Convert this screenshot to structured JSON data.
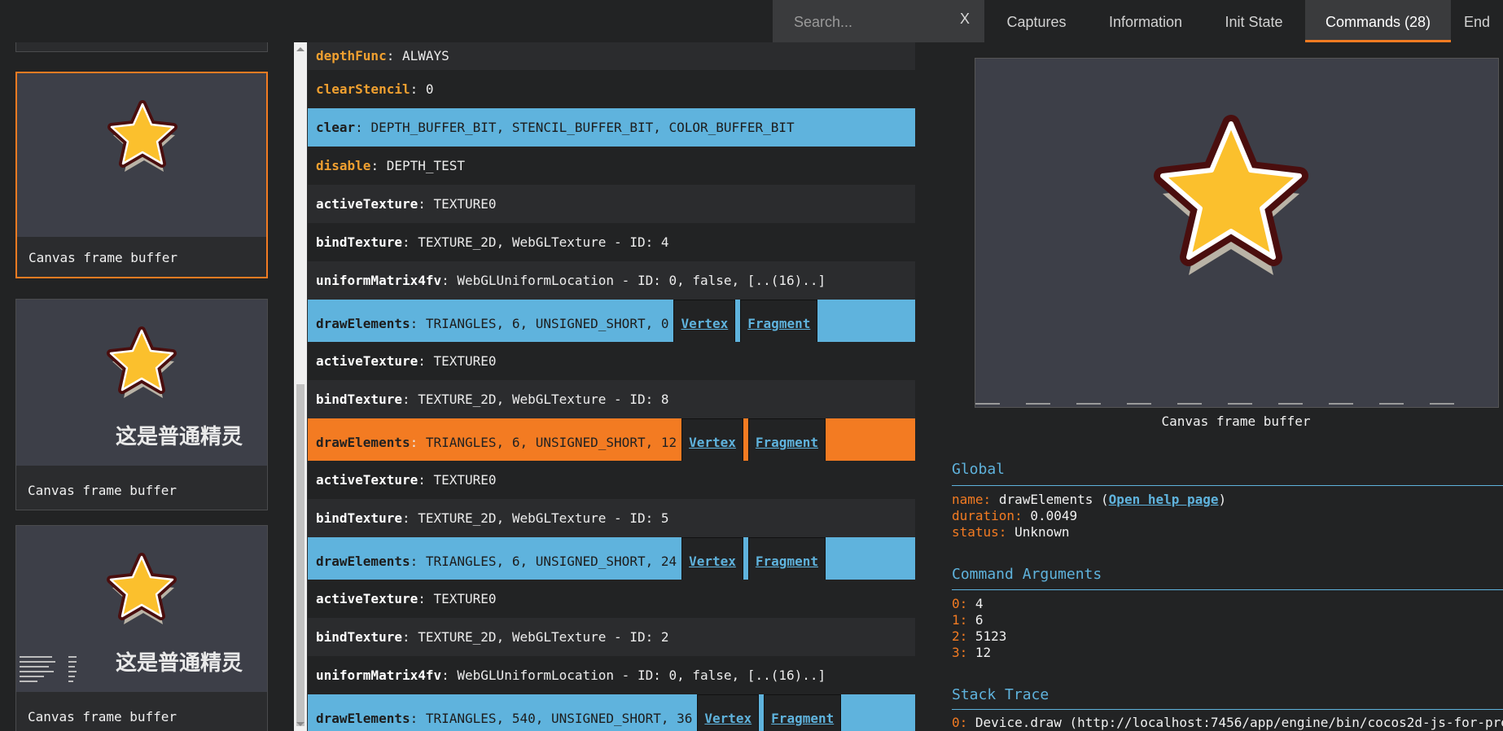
{
  "search": {
    "placeholder": "Search...",
    "clear_label": "X"
  },
  "tabs": [
    {
      "label": "Captures"
    },
    {
      "label": "Information"
    },
    {
      "label": "Init State"
    },
    {
      "label": "Commands (28)"
    },
    {
      "label": "End"
    }
  ],
  "thumbnails": [
    {
      "caption": "Canvas frame buffer",
      "overlay_text": ""
    },
    {
      "caption": "Canvas frame buffer",
      "overlay_text": "这是普通精灵"
    },
    {
      "caption": "Canvas frame buffer",
      "overlay_text": "这是普通精灵"
    }
  ],
  "commands": [
    {
      "name": "depthFunc",
      "args": "ALWAYS",
      "kind": "state"
    },
    {
      "name": "clearStencil",
      "args": "0",
      "kind": "state"
    },
    {
      "name": "clear",
      "args": "DEPTH_BUFFER_BIT, STENCIL_BUFFER_BIT, COLOR_BUFFER_BIT",
      "kind": "draw"
    },
    {
      "name": "disable",
      "args": "DEPTH_TEST",
      "kind": "state"
    },
    {
      "name": "activeTexture",
      "args": "TEXTURE0",
      "kind": "normal"
    },
    {
      "name": "bindTexture",
      "args": "TEXTURE_2D, WebGLTexture - ID: 4",
      "kind": "normal"
    },
    {
      "name": "uniformMatrix4fv",
      "args": "WebGLUniformLocation - ID: 0, false, [..(16)..]",
      "kind": "normal"
    },
    {
      "name": "drawElements",
      "args": "TRIANGLES, 6, UNSIGNED_SHORT, 0",
      "kind": "draw",
      "buttons": [
        "Vertex",
        "Fragment"
      ]
    },
    {
      "name": "activeTexture",
      "args": "TEXTURE0",
      "kind": "normal"
    },
    {
      "name": "bindTexture",
      "args": "TEXTURE_2D, WebGLTexture - ID: 8",
      "kind": "normal"
    },
    {
      "name": "drawElements",
      "args": "TRIANGLES, 6, UNSIGNED_SHORT, 12",
      "kind": "selected",
      "buttons": [
        "Vertex",
        "Fragment"
      ]
    },
    {
      "name": "activeTexture",
      "args": "TEXTURE0",
      "kind": "normal"
    },
    {
      "name": "bindTexture",
      "args": "TEXTURE_2D, WebGLTexture - ID: 5",
      "kind": "normal"
    },
    {
      "name": "drawElements",
      "args": "TRIANGLES, 6, UNSIGNED_SHORT, 24",
      "kind": "draw",
      "buttons": [
        "Vertex",
        "Fragment"
      ]
    },
    {
      "name": "activeTexture",
      "args": "TEXTURE0",
      "kind": "normal"
    },
    {
      "name": "bindTexture",
      "args": "TEXTURE_2D, WebGLTexture - ID: 2",
      "kind": "normal"
    },
    {
      "name": "uniformMatrix4fv",
      "args": "WebGLUniformLocation - ID: 0, false, [..(16)..]",
      "kind": "normal"
    },
    {
      "name": "drawElements",
      "args": "TRIANGLES, 540, UNSIGNED_SHORT, 36",
      "kind": "draw",
      "buttons": [
        "Vertex",
        "Fragment"
      ]
    }
  ],
  "preview": {
    "caption": "Canvas frame buffer"
  },
  "global": {
    "title": "Global",
    "name_key": "name:",
    "name_value": "drawElements",
    "help_link": "Open help page",
    "duration_key": "duration:",
    "duration_value": "0.0049",
    "status_key": "status:",
    "status_value": "Unknown"
  },
  "arguments": {
    "title": "Command Arguments",
    "items": [
      {
        "key": "0:",
        "value": "4"
      },
      {
        "key": "1:",
        "value": "6"
      },
      {
        "key": "2:",
        "value": "5123"
      },
      {
        "key": "3:",
        "value": "12"
      }
    ]
  },
  "stack": {
    "title": "Stack Trace",
    "items": [
      {
        "key": "0:",
        "value": "Device.draw (http://localhost:7456/app/engine/bin/cocos2d-js-for-pre"
      }
    ]
  },
  "colors": {
    "accent": "#f37b22",
    "draw_row": "#5fb3dd",
    "state_cmd": "#f0a030",
    "star_fill": "#fbc02d",
    "star_outline": "#4a0e0e"
  }
}
